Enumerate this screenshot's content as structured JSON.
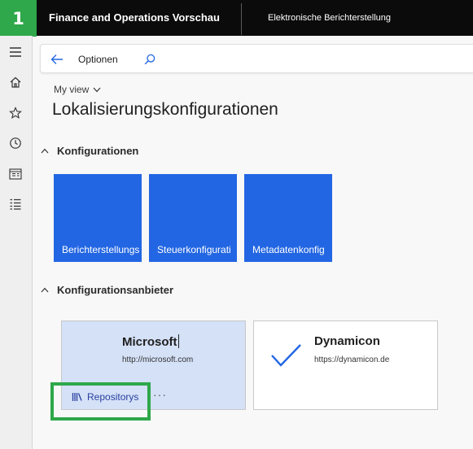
{
  "step_badge": "1",
  "header": {
    "app_title": "Finance and Operations Vorschau",
    "module_title": "Elektronische Berichterstellung"
  },
  "nav": {
    "items": [
      {
        "icon": "hamburger-icon"
      },
      {
        "icon": "home-icon"
      },
      {
        "icon": "star-icon"
      },
      {
        "icon": "clock-icon"
      },
      {
        "icon": "workspace-icon"
      },
      {
        "icon": "list-icon"
      }
    ]
  },
  "actionbar": {
    "back_icon": "back-arrow-icon",
    "options_label": "Optionen",
    "search_icon": "search-icon"
  },
  "page": {
    "view_label": "My view",
    "title": "Lokalisierungskonfigurationen"
  },
  "sections": {
    "configurations": {
      "title": "Konfigurationen",
      "tiles": [
        {
          "label": "Berichterstellungs"
        },
        {
          "label": "Steuerkonfigurati"
        },
        {
          "label": "Metadatenkonfig"
        }
      ]
    },
    "providers": {
      "title": "Konfigurationsanbieter",
      "cards": [
        {
          "name": "Microsoft",
          "url": "http://microsoft.com",
          "link_label": "Repositorys",
          "more_label": "···"
        },
        {
          "name": "Dynamicon",
          "url": "https://dynamicon.de"
        }
      ]
    }
  },
  "colors": {
    "accent_green": "#2ea84a",
    "tile_blue": "#2266e3",
    "active_card": "#d4e1f7",
    "topbar": "#0b0b0b"
  }
}
